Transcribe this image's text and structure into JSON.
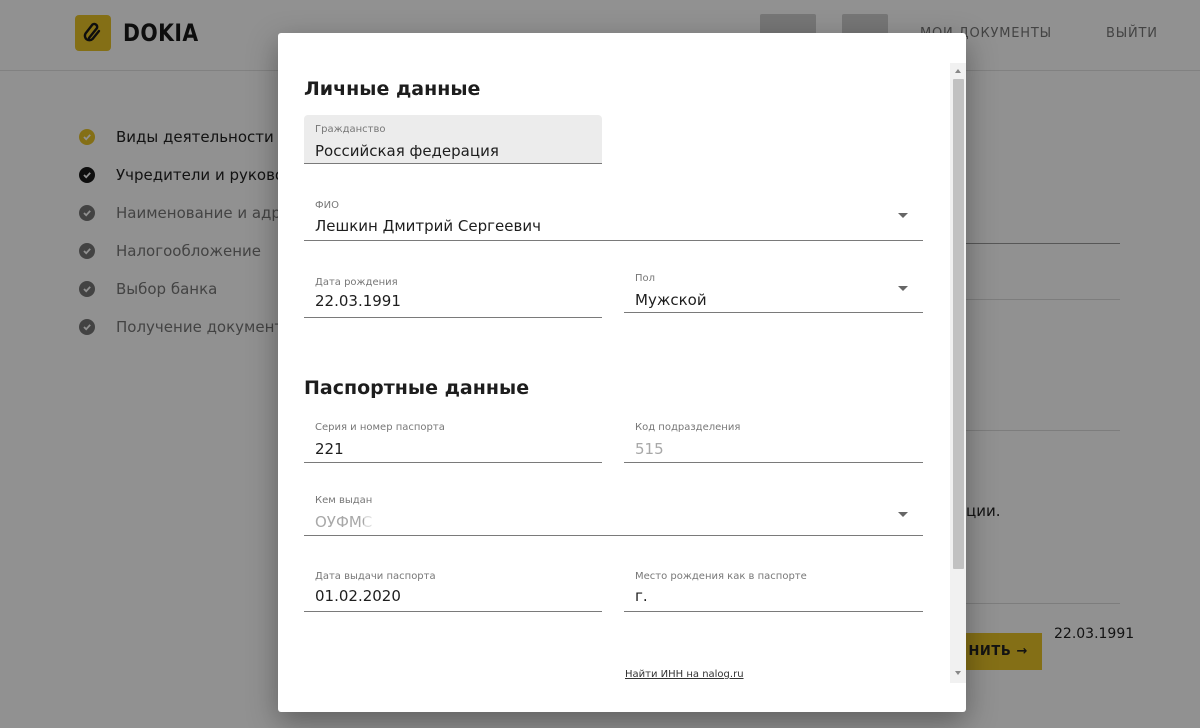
{
  "header": {
    "logo_text": "DOKIA",
    "logo_icon": "paperclip-icon",
    "nav": [
      "МОИ ДОКУМЕНТЫ",
      "ВЫЙТИ"
    ]
  },
  "steps": [
    {
      "label": "Виды деятельности",
      "status": "done",
      "color": "#e9c327"
    },
    {
      "label": "Учредители и руководство",
      "status": "current",
      "color": "#1a1a1a"
    },
    {
      "label": "Наименование и адрес",
      "status": "todo",
      "color": "#777777"
    },
    {
      "label": "Налогообложение",
      "status": "todo",
      "color": "#777777"
    },
    {
      "label": "Выбор банка",
      "status": "todo",
      "color": "#777777"
    },
    {
      "label": "Получение документов",
      "status": "todo",
      "color": "#777777"
    }
  ],
  "background": {
    "text_fragment": "ции.",
    "date_fragment": "22.03.1991",
    "button_label": "НИТЬ →"
  },
  "modal": {
    "personal_title": "Личные данные",
    "citizenship": {
      "label": "Гражданство",
      "value": "Российская федерация"
    },
    "fio": {
      "label": "ФИО",
      "value": "Лешкин Дмитрий Сергеевич"
    },
    "birth_date": {
      "label": "Дата рождения",
      "value": "22.03.1991"
    },
    "gender": {
      "label": "Пол",
      "value": "Мужской"
    },
    "passport_title": "Паспортные данные",
    "passport_number": {
      "label": "Серия и номер паспорта",
      "value": "221"
    },
    "division_code": {
      "label": "Код подразделения",
      "value": "515"
    },
    "issued_by": {
      "label": "Кем выдан",
      "value": "ОУФМС"
    },
    "issue_date": {
      "label": "Дата выдачи паспорта",
      "value": "01.02.2020"
    },
    "birth_place": {
      "label": "Место рождения как в паспорте",
      "value": "г."
    },
    "inn_link": "Найти ИНН на nalog.ru"
  },
  "colors": {
    "accent": "#e9c327"
  }
}
